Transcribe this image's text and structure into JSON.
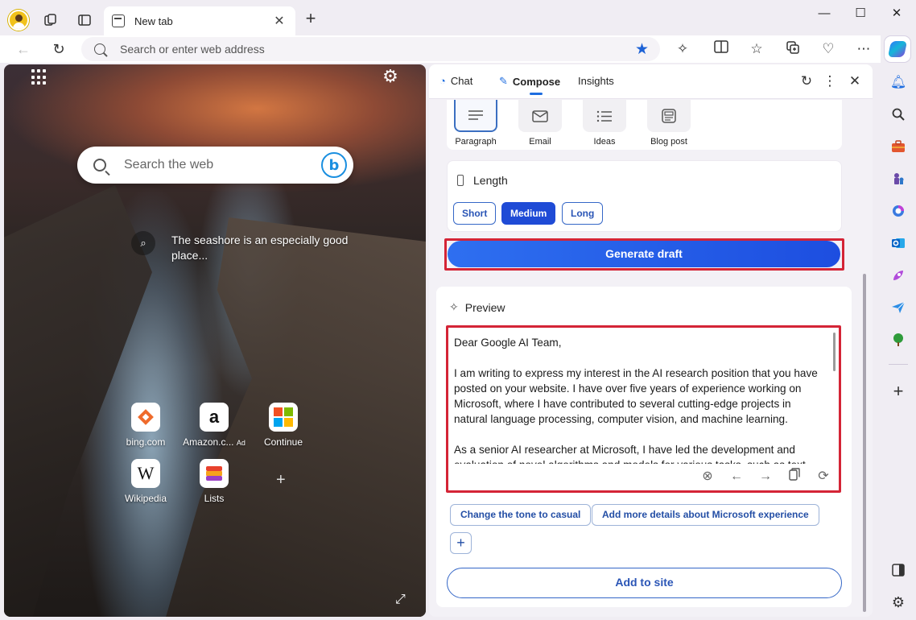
{
  "browser": {
    "tab_title": "New tab",
    "address_placeholder": "Search or enter web address"
  },
  "newtab": {
    "search_placeholder": "Search the web",
    "caption": "The seashore is an especially good place...",
    "tiles": [
      {
        "label": "bing.com"
      },
      {
        "label": "Amazon.c...",
        "badge": "Ad"
      },
      {
        "label": "Continue"
      },
      {
        "label": "Wikipedia"
      },
      {
        "label": "Lists"
      }
    ]
  },
  "copilot": {
    "tabs": [
      {
        "label": "Chat"
      },
      {
        "label": "Compose"
      },
      {
        "label": "Insights"
      }
    ],
    "active_tab": "Compose",
    "formats": [
      {
        "label": "Paragraph",
        "selected": true
      },
      {
        "label": "Email"
      },
      {
        "label": "Ideas"
      },
      {
        "label": "Blog post"
      }
    ],
    "length": {
      "title": "Length",
      "options": [
        "Short",
        "Medium",
        "Long"
      ],
      "selected": "Medium"
    },
    "generate_label": "Generate draft",
    "preview": {
      "title": "Preview",
      "paragraphs": [
        "Dear Google AI Team,",
        "I am writing to express my interest in the AI research position that you have posted on your website. I have over five years of experience working on Microsoft, where I have contributed to several cutting-edge projects in natural language processing, computer vision, and machine learning.",
        "As a senior AI researcher at Microsoft, I have led the development and evaluation of novel algorithms and models for various tasks, such as text"
      ]
    },
    "suggestions": [
      "Change the tone to casual",
      "Add more details about Microsoft experience"
    ],
    "add_to_site_label": "Add to site"
  },
  "colors": {
    "accent": "#1f4bd6",
    "highlight": "#d42436",
    "favorite_star": "#1d62d6"
  }
}
